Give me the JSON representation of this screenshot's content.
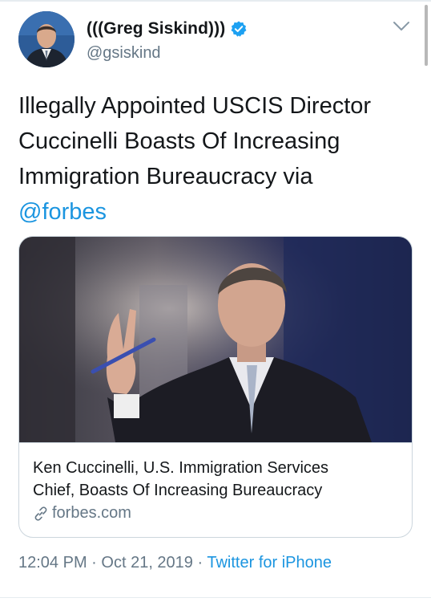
{
  "user": {
    "display_name": "(((Greg Siskind)))",
    "handle": "@gsiskind",
    "verified": true
  },
  "tweet": {
    "lines": [
      "Illegally Appointed USCIS Director",
      "Cuccinelli Boasts Of Increasing",
      "Immigration Bureaucracy via"
    ],
    "mention": "@forbes"
  },
  "card": {
    "title_lines": [
      "Ken Cuccinelli, U.S. Immigration Services",
      "Chief, Boasts Of Increasing Bureaucracy"
    ],
    "domain": "forbes.com"
  },
  "meta": {
    "time": "12:04 PM",
    "date": "Oct 21, 2019",
    "separator": "·",
    "source": "Twitter for iPhone"
  },
  "colors": {
    "link": "#1b95e0",
    "secondary_text": "#657786",
    "verified_badge": "#1da1f2",
    "border": "#ccd6dd"
  },
  "icons": [
    "verified-badge-icon",
    "chevron-down-icon",
    "link-icon"
  ]
}
